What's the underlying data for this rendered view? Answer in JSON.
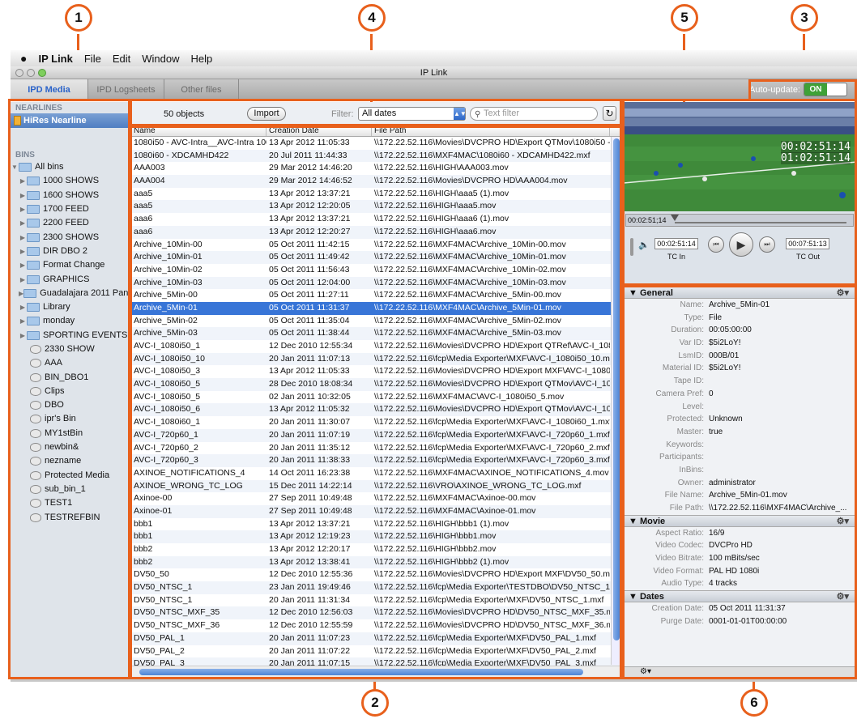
{
  "callouts": [
    "1",
    "4",
    "5",
    "3",
    "2",
    "6"
  ],
  "menubar": {
    "apple": "",
    "app": "IP Link",
    "items": [
      "File",
      "Edit",
      "Window",
      "Help"
    ]
  },
  "window": {
    "title": "IP Link"
  },
  "tabs": [
    "IPD Media",
    "IPD Logsheets",
    "Other files"
  ],
  "autoupdate": {
    "label": "Auto-update:",
    "state": "ON"
  },
  "sidebar": {
    "nearlines_header": "NEARLINES",
    "nearline": "HiRes Nearline",
    "bins_header": "BINS",
    "tree": [
      {
        "type": "root",
        "label": "All bins"
      },
      {
        "type": "folder",
        "label": "1000 SHOWS"
      },
      {
        "type": "folder",
        "label": "1600 SHOWS"
      },
      {
        "type": "folder",
        "label": "1700 FEED"
      },
      {
        "type": "folder",
        "label": "2200 FEED"
      },
      {
        "type": "folder",
        "label": "2300 SHOWS"
      },
      {
        "type": "folder",
        "label": "DIR DBO 2"
      },
      {
        "type": "folder",
        "label": "Format Change"
      },
      {
        "type": "folder",
        "label": "GRAPHICS"
      },
      {
        "type": "folder",
        "label": "Guadalajara 2011 Pan..."
      },
      {
        "type": "folder",
        "label": "Library"
      },
      {
        "type": "folder",
        "label": "monday"
      },
      {
        "type": "folder",
        "label": "SPORTING EVENTS"
      },
      {
        "type": "bin",
        "label": "2330 SHOW"
      },
      {
        "type": "bin",
        "label": "AAA"
      },
      {
        "type": "bin",
        "label": "BIN_DBO1"
      },
      {
        "type": "bin",
        "label": "Clips"
      },
      {
        "type": "bin",
        "label": "DBO"
      },
      {
        "type": "bin",
        "label": "ipr's Bin"
      },
      {
        "type": "bin",
        "label": "MY1stBin"
      },
      {
        "type": "bin",
        "label": "newbin&"
      },
      {
        "type": "bin",
        "label": "nezname"
      },
      {
        "type": "bin",
        "label": "Protected Media"
      },
      {
        "type": "bin",
        "label": "sub_bin_1"
      },
      {
        "type": "bin",
        "label": "TEST1"
      },
      {
        "type": "bin",
        "label": "TESTREFBIN"
      }
    ]
  },
  "list": {
    "count": "50 objects",
    "import": "Import",
    "filter_label": "Filter:",
    "filter_value": "All dates",
    "text_filter_placeholder": "Text filter",
    "columns": [
      "Name",
      "Creation Date",
      "File Path"
    ],
    "selected_index": 15,
    "rows": [
      [
        "1080i50 - AVC-Intra__AVC-Intra 100",
        "13 Apr 2012 11:05:33",
        "\\\\172.22.52.116\\Movies\\DVCPRO HD\\Export QTMov\\1080i50 -"
      ],
      [
        "1080i60 - XDCAMHD422",
        "20 Jul 2011 11:44:33",
        "\\\\172.22.52.116\\MXF4MAC\\1080i60 - XDCAMHD422.mxf"
      ],
      [
        "AAA003",
        "29 Mar 2012 14:46:20",
        "\\\\172.22.52.116\\HIGH\\AAA003.mov"
      ],
      [
        "AAA004",
        "29 Mar 2012 14:46:52",
        "\\\\172.22.52.116\\Movies\\DVCPRO HD\\AAA004.mov"
      ],
      [
        "aaa5",
        "13 Apr 2012 13:37:21",
        "\\\\172.22.52.116\\HIGH\\aaa5 (1).mov"
      ],
      [
        "aaa5",
        "13 Apr 2012 12:20:05",
        "\\\\172.22.52.116\\HIGH\\aaa5.mov"
      ],
      [
        "aaa6",
        "13 Apr 2012 13:37:21",
        "\\\\172.22.52.116\\HIGH\\aaa6 (1).mov"
      ],
      [
        "aaa6",
        "13 Apr 2012 12:20:27",
        "\\\\172.22.52.116\\HIGH\\aaa6.mov"
      ],
      [
        "Archive_10Min-00",
        "05 Oct 2011 11:42:15",
        "\\\\172.22.52.116\\MXF4MAC\\Archive_10Min-00.mov"
      ],
      [
        "Archive_10Min-01",
        "05 Oct 2011 11:49:42",
        "\\\\172.22.52.116\\MXF4MAC\\Archive_10Min-01.mov"
      ],
      [
        "Archive_10Min-02",
        "05 Oct 2011 11:56:43",
        "\\\\172.22.52.116\\MXF4MAC\\Archive_10Min-02.mov"
      ],
      [
        "Archive_10Min-03",
        "05 Oct 2011 12:04:00",
        "\\\\172.22.52.116\\MXF4MAC\\Archive_10Min-03.mov"
      ],
      [
        "Archive_5Min-00",
        "05 Oct 2011 11:27:11",
        "\\\\172.22.52.116\\MXF4MAC\\Archive_5Min-00.mov"
      ],
      [
        "Archive_5Min-01",
        "05 Oct 2011 11:31:37",
        "\\\\172.22.52.116\\MXF4MAC\\Archive_5Min-01.mov"
      ],
      [
        "Archive_5Min-02",
        "05 Oct 2011 11:35:04",
        "\\\\172.22.52.116\\MXF4MAC\\Archive_5Min-02.mov"
      ],
      [
        "Archive_5Min-03",
        "05 Oct 2011 11:38:44",
        "\\\\172.22.52.116\\MXF4MAC\\Archive_5Min-03.mov"
      ],
      [
        "AVC-I_1080i50_1",
        "12 Dec 2010 12:55:34",
        "\\\\172.22.52.116\\Movies\\DVCPRO HD\\Export QTRef\\AVC-I_108..."
      ],
      [
        "AVC-I_1080i50_10",
        "20 Jan 2011 11:07:13",
        "\\\\172.22.52.116\\fcp\\Media Exporter\\MXF\\AVC-I_1080i50_10.m"
      ],
      [
        "AVC-I_1080i50_3",
        "13 Apr 2012 11:05:33",
        "\\\\172.22.52.116\\Movies\\DVCPRO HD\\Export MXF\\AVC-I_1080i5"
      ],
      [
        "AVC-I_1080i50_5",
        "28 Dec 2010 18:08:34",
        "\\\\172.22.52.116\\Movies\\DVCPRO HD\\Export QTMov\\AVC-I_108..."
      ],
      [
        "AVC-I_1080i50_5",
        "02 Jan 2011 10:32:05",
        "\\\\172.22.52.116\\MXF4MAC\\AVC-I_1080i50_5.mov"
      ],
      [
        "AVC-I_1080i50_6",
        "13 Apr 2012 11:05:32",
        "\\\\172.22.52.116\\Movies\\DVCPRO HD\\Export QTMov\\AVC-I_108..."
      ],
      [
        "AVC-I_1080i60_1",
        "20 Jan 2011 11:30:07",
        "\\\\172.22.52.116\\fcp\\Media Exporter\\MXF\\AVC-I_1080i60_1.mxf"
      ],
      [
        "AVC-I_720p60_1",
        "20 Jan 2011 11:07:19",
        "\\\\172.22.52.116\\fcp\\Media Exporter\\MXF\\AVC-I_720p60_1.mxf"
      ],
      [
        "AVC-I_720p60_2",
        "20 Jan 2011 11:35:12",
        "\\\\172.22.52.116\\fcp\\Media Exporter\\MXF\\AVC-I_720p60_2.mxf"
      ],
      [
        "AVC-I_720p60_3",
        "20 Jan 2011 11:38:33",
        "\\\\172.22.52.116\\fcp\\Media Exporter\\MXF\\AVC-I_720p60_3.mxf"
      ],
      [
        "AXINOE_NOTIFICATIONS_4",
        "14 Oct 2011 16:23:38",
        "\\\\172.22.52.116\\MXF4MAC\\AXINOE_NOTIFICATIONS_4.mov"
      ],
      [
        "AXINOE_WRONG_TC_LOG",
        "15 Dec 2011 14:22:14",
        "\\\\172.22.52.116\\VRO\\AXINOE_WRONG_TC_LOG.mxf"
      ],
      [
        "Axinoe-00",
        "27 Sep 2011 10:49:48",
        "\\\\172.22.52.116\\MXF4MAC\\Axinoe-00.mov"
      ],
      [
        "Axinoe-01",
        "27 Sep 2011 10:49:48",
        "\\\\172.22.52.116\\MXF4MAC\\Axinoe-01.mov"
      ],
      [
        "bbb1",
        "13 Apr 2012 13:37:21",
        "\\\\172.22.52.116\\HIGH\\bbb1 (1).mov"
      ],
      [
        "bbb1",
        "13 Apr 2012 12:19:23",
        "\\\\172.22.52.116\\HIGH\\bbb1.mov"
      ],
      [
        "bbb2",
        "13 Apr 2012 12:20:17",
        "\\\\172.22.52.116\\HIGH\\bbb2.mov"
      ],
      [
        "bbb2",
        "13 Apr 2012 13:38:41",
        "\\\\172.22.52.116\\HIGH\\bbb2 (1).mov"
      ],
      [
        "DV50_50",
        "12 Dec 2010 12:55:36",
        "\\\\172.22.52.116\\Movies\\DVCPRO HD\\Export MXF\\DV50_50.mxf"
      ],
      [
        "DV50_NTSC_1",
        "23 Jan 2011 19:49:46",
        "\\\\172.22.52.116\\fcp\\Media Exporter\\TESTDBO\\DV50_NTSC_1.m"
      ],
      [
        "DV50_NTSC_1",
        "20 Jan 2011 11:31:34",
        "\\\\172.22.52.116\\fcp\\Media Exporter\\MXF\\DV50_NTSC_1.mxf"
      ],
      [
        "DV50_NTSC_MXF_35",
        "12 Dec 2010 12:56:03",
        "\\\\172.22.52.116\\Movies\\DVCPRO HD\\DV50_NTSC_MXF_35.mxf"
      ],
      [
        "DV50_NTSC_MXF_36",
        "12 Dec 2010 12:55:59",
        "\\\\172.22.52.116\\Movies\\DVCPRO HD\\DV50_NTSC_MXF_36.mov"
      ],
      [
        "DV50_PAL_1",
        "20 Jan 2011 11:07:23",
        "\\\\172.22.52.116\\fcp\\Media Exporter\\MXF\\DV50_PAL_1.mxf"
      ],
      [
        "DV50_PAL_2",
        "20 Jan 2011 11:07:22",
        "\\\\172.22.52.116\\fcp\\Media Exporter\\MXF\\DV50_PAL_2.mxf"
      ],
      [
        "DV50_PAL_3",
        "20 Jan 2011 11:07:15",
        "\\\\172.22.52.116\\fcp\\Media Exporter\\MXF\\DV50_PAL_3.mxf"
      ]
    ]
  },
  "player": {
    "overlay_tc1": "00:02:51:14",
    "overlay_tc2": "01:02:51:14",
    "scrub_tc": "00:02:51;14",
    "tc_in_value": "00:02:51:14",
    "tc_in_label": "TC In",
    "tc_out_value": "00:07:51:13",
    "tc_out_label": "TC Out"
  },
  "properties": {
    "general_title": "General",
    "general": [
      [
        "Name:",
        "Archive_5Min-01"
      ],
      [
        "Type:",
        "File"
      ],
      [
        "Duration:",
        "00:05:00:00"
      ],
      [
        "Var ID:",
        "$5i2LoY!"
      ],
      [
        "LsmID:",
        "000B/01"
      ],
      [
        "Material ID:",
        "$5i2LoY!"
      ],
      [
        "Tape ID:",
        ""
      ],
      [
        "Camera Pref:",
        "0"
      ],
      [
        "Level:",
        ""
      ],
      [
        "Protected:",
        "Unknown"
      ],
      [
        "Master:",
        "true"
      ],
      [
        "Keywords:",
        ""
      ],
      [
        "Participants:",
        ""
      ],
      [
        "InBins:",
        ""
      ],
      [
        "Owner:",
        "administrator"
      ],
      [
        "File Name:",
        "Archive_5Min-01.mov"
      ],
      [
        "File Path:",
        "\\\\172.22.52.116\\MXF4MAC\\Archive_..."
      ]
    ],
    "movie_title": "Movie",
    "movie": [
      [
        "Aspect Ratio:",
        "16/9"
      ],
      [
        "Video Codec:",
        "DVCPro HD"
      ],
      [
        "Video Bitrate:",
        "100 mBits/sec"
      ],
      [
        "Video Format:",
        "PAL HD 1080i"
      ],
      [
        "Audio Type:",
        "4 tracks"
      ]
    ],
    "dates_title": "Dates",
    "dates": [
      [
        "Creation Date:",
        "05 Oct 2011 11:31:37"
      ],
      [
        "Purge Date:",
        "0001-01-01T00:00:00"
      ]
    ]
  }
}
